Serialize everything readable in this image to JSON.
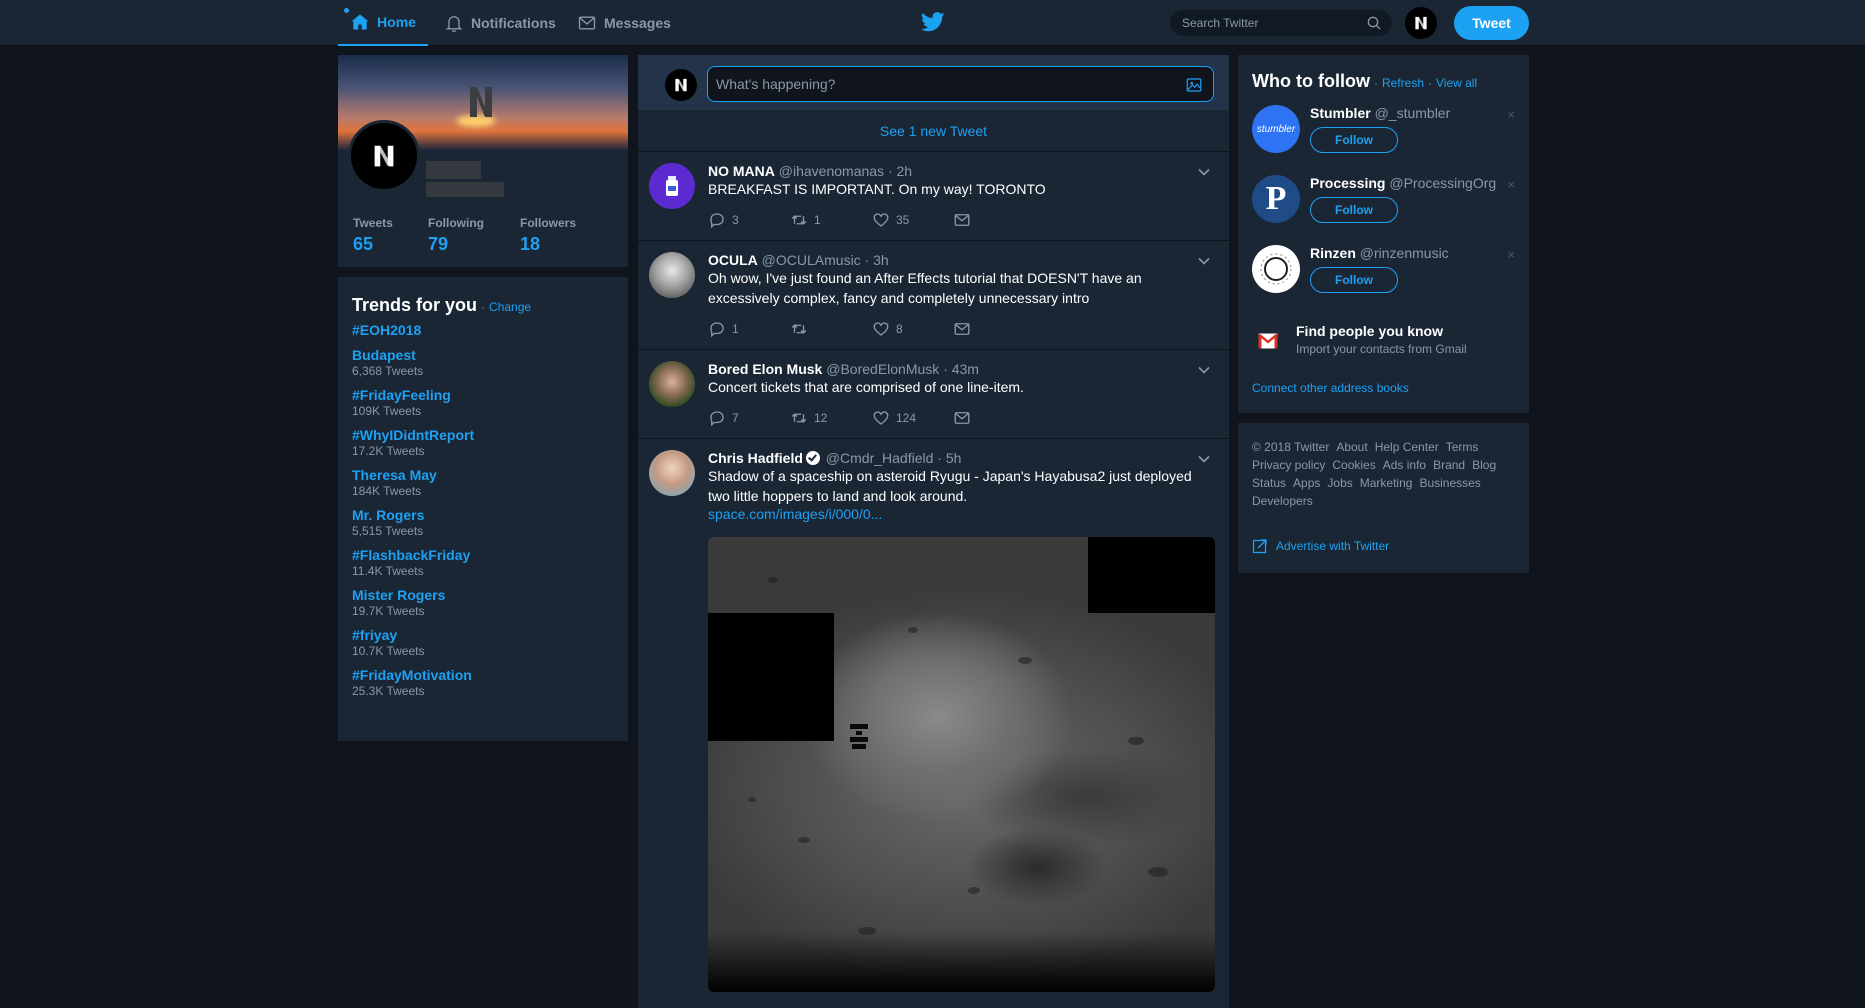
{
  "nav": {
    "home_label": "Home",
    "notifications_label": "Notifications",
    "messages_label": "Messages",
    "search_placeholder": "Search Twitter",
    "tweet_button_label": "Tweet"
  },
  "profile": {
    "stats": [
      {
        "label": "Tweets",
        "value": "65"
      },
      {
        "label": "Following",
        "value": "79"
      },
      {
        "label": "Followers",
        "value": "18"
      }
    ]
  },
  "trends": {
    "title": "Trends for you",
    "change_label": "Change",
    "items": [
      {
        "name": "#EOH2018",
        "count": ""
      },
      {
        "name": "Budapest",
        "count": "6,368 Tweets"
      },
      {
        "name": "#FridayFeeling",
        "count": "109K Tweets"
      },
      {
        "name": "#WhyIDidntReport",
        "count": "17.2K Tweets"
      },
      {
        "name": "Theresa May",
        "count": "184K Tweets"
      },
      {
        "name": "Mr. Rogers",
        "count": "5,515 Tweets"
      },
      {
        "name": "#FlashbackFriday",
        "count": "11.4K Tweets"
      },
      {
        "name": "Mister Rogers",
        "count": "19.7K Tweets"
      },
      {
        "name": "#friyay",
        "count": "10.7K Tweets"
      },
      {
        "name": "#FridayMotivation",
        "count": "25.3K Tweets"
      }
    ]
  },
  "compose": {
    "placeholder": "What's happening?"
  },
  "timeline": {
    "new_tweets_label": "See 1 new Tweet",
    "tweets": [
      {
        "name": "NO MANA",
        "handle": "@ihavenomanas",
        "time": "· 2h",
        "text": "BREAKFAST IS IMPORTANT. On my way! TORONTO",
        "replies": "3",
        "retweets": "1",
        "likes": "35"
      },
      {
        "name": "OCULA",
        "handle": "@OCULAmusic",
        "time": "· 3h",
        "text": "Oh wow, I've just found an After Effects tutorial that DOESN'T have an excessively complex, fancy and completely unnecessary intro",
        "replies": "1",
        "retweets": "",
        "likes": "8"
      },
      {
        "name": "Bored Elon Musk",
        "handle": "@BoredElonMusk",
        "time": "· 43m",
        "text": "Concert tickets that are comprised of one line-item.",
        "replies": "7",
        "retweets": "12",
        "likes": "124"
      },
      {
        "name": "Chris Hadfield",
        "handle": "@Cmdr_Hadfield",
        "time": "· 5h",
        "text": "Shadow of a spaceship on asteroid Ryugu - Japan's Hayabusa2 just deployed two little hoppers to land and look around.",
        "link": "space.com/images/i/000/0..."
      }
    ]
  },
  "who_to_follow": {
    "title": "Who to follow",
    "refresh_label": "Refresh",
    "view_all_label": "View all",
    "follow_label": "Follow",
    "close_glyph": "×",
    "suggestions": [
      {
        "name": "Stumbler",
        "handle": "@_stumbler",
        "avatar_text": "stumbler"
      },
      {
        "name": "Processing",
        "handle": "@ProcessingOrg",
        "avatar_text": "P"
      },
      {
        "name": "Rinzen",
        "handle": "@rinzenmusic",
        "avatar_text": ""
      }
    ],
    "find_title": "Find people you know",
    "find_sub": "Import your contacts from Gmail",
    "connect_label": "Connect other address books"
  },
  "footer": {
    "links": [
      "© 2018 Twitter",
      "About",
      "Help Center",
      "Terms",
      "Privacy policy",
      "Cookies",
      "Ads info",
      "Brand",
      "Blog",
      "Status",
      "Apps",
      "Jobs",
      "Marketing",
      "Businesses",
      "Developers"
    ],
    "advertise_label": "Advertise with Twitter"
  },
  "colors": {
    "background": "#10141c",
    "card": "#1b2635",
    "accent": "#1da1f2",
    "muted": "#8899a6"
  }
}
